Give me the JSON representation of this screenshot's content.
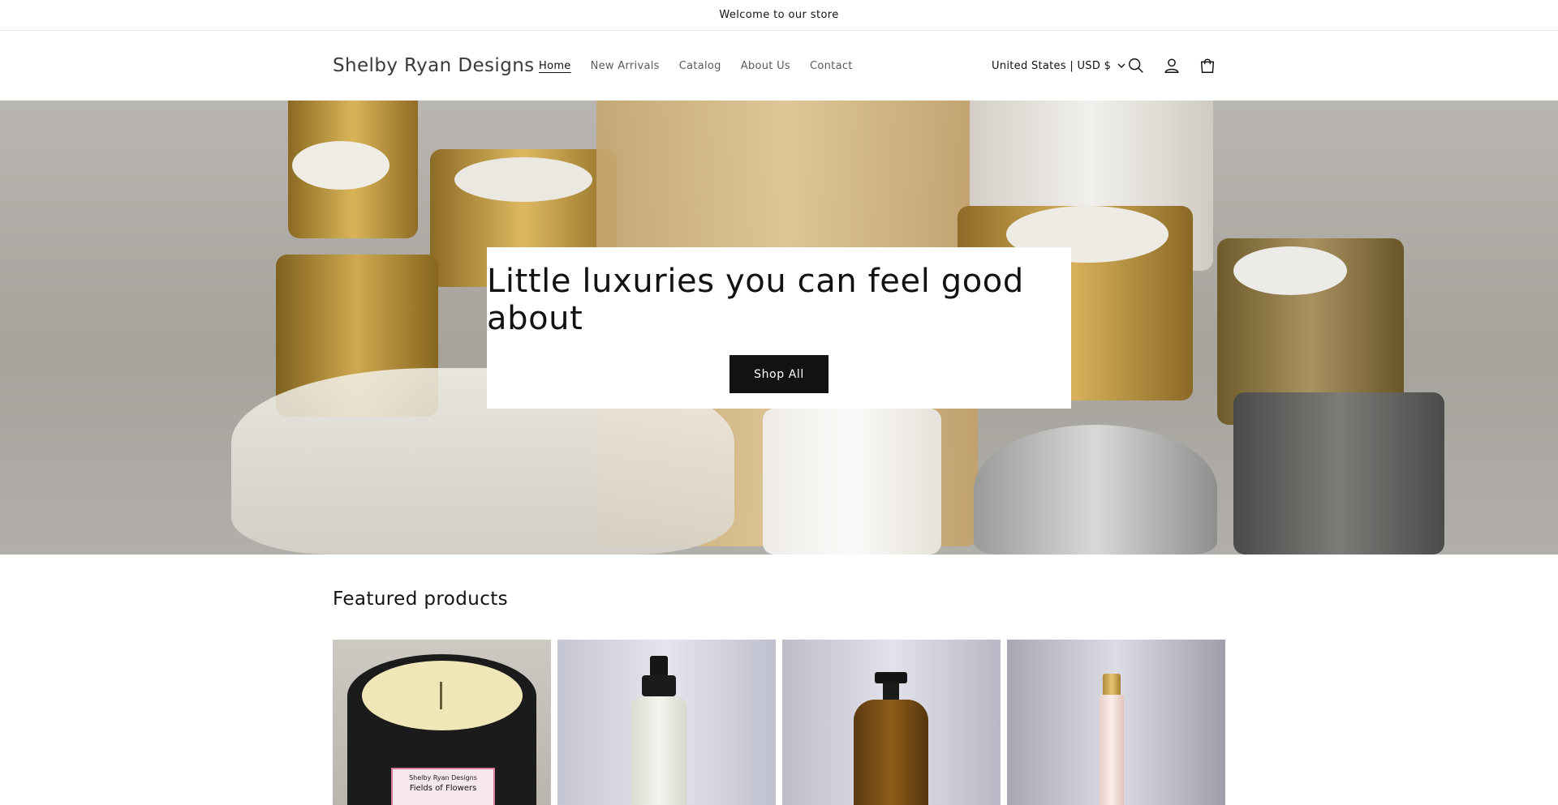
{
  "announcement": {
    "text": "Welcome to our store"
  },
  "header": {
    "logo": "Shelby Ryan Designs",
    "nav": [
      {
        "label": "Home",
        "active": true
      },
      {
        "label": "New Arrivals",
        "active": false
      },
      {
        "label": "Catalog",
        "active": false
      },
      {
        "label": "About Us",
        "active": false
      },
      {
        "label": "Contact",
        "active": false
      }
    ],
    "locale": "United States | USD $",
    "icons": [
      "search-icon",
      "account-icon",
      "cart-icon"
    ]
  },
  "hero": {
    "heading": "Little luxuries you can feel good about",
    "button": "Shop All"
  },
  "featured": {
    "title": "Featured products",
    "products": [
      {
        "image": "fields-of-flowers-candle",
        "label": "Shelby Ryan Designs",
        "sublabel": "Fields of Flowers"
      },
      {
        "image": "spray-bottle"
      },
      {
        "image": "pump-bottle"
      },
      {
        "image": "roller-perfume"
      }
    ]
  },
  "colors": {
    "text": "#121212",
    "button_bg": "#121212",
    "button_text": "#ffffff"
  }
}
